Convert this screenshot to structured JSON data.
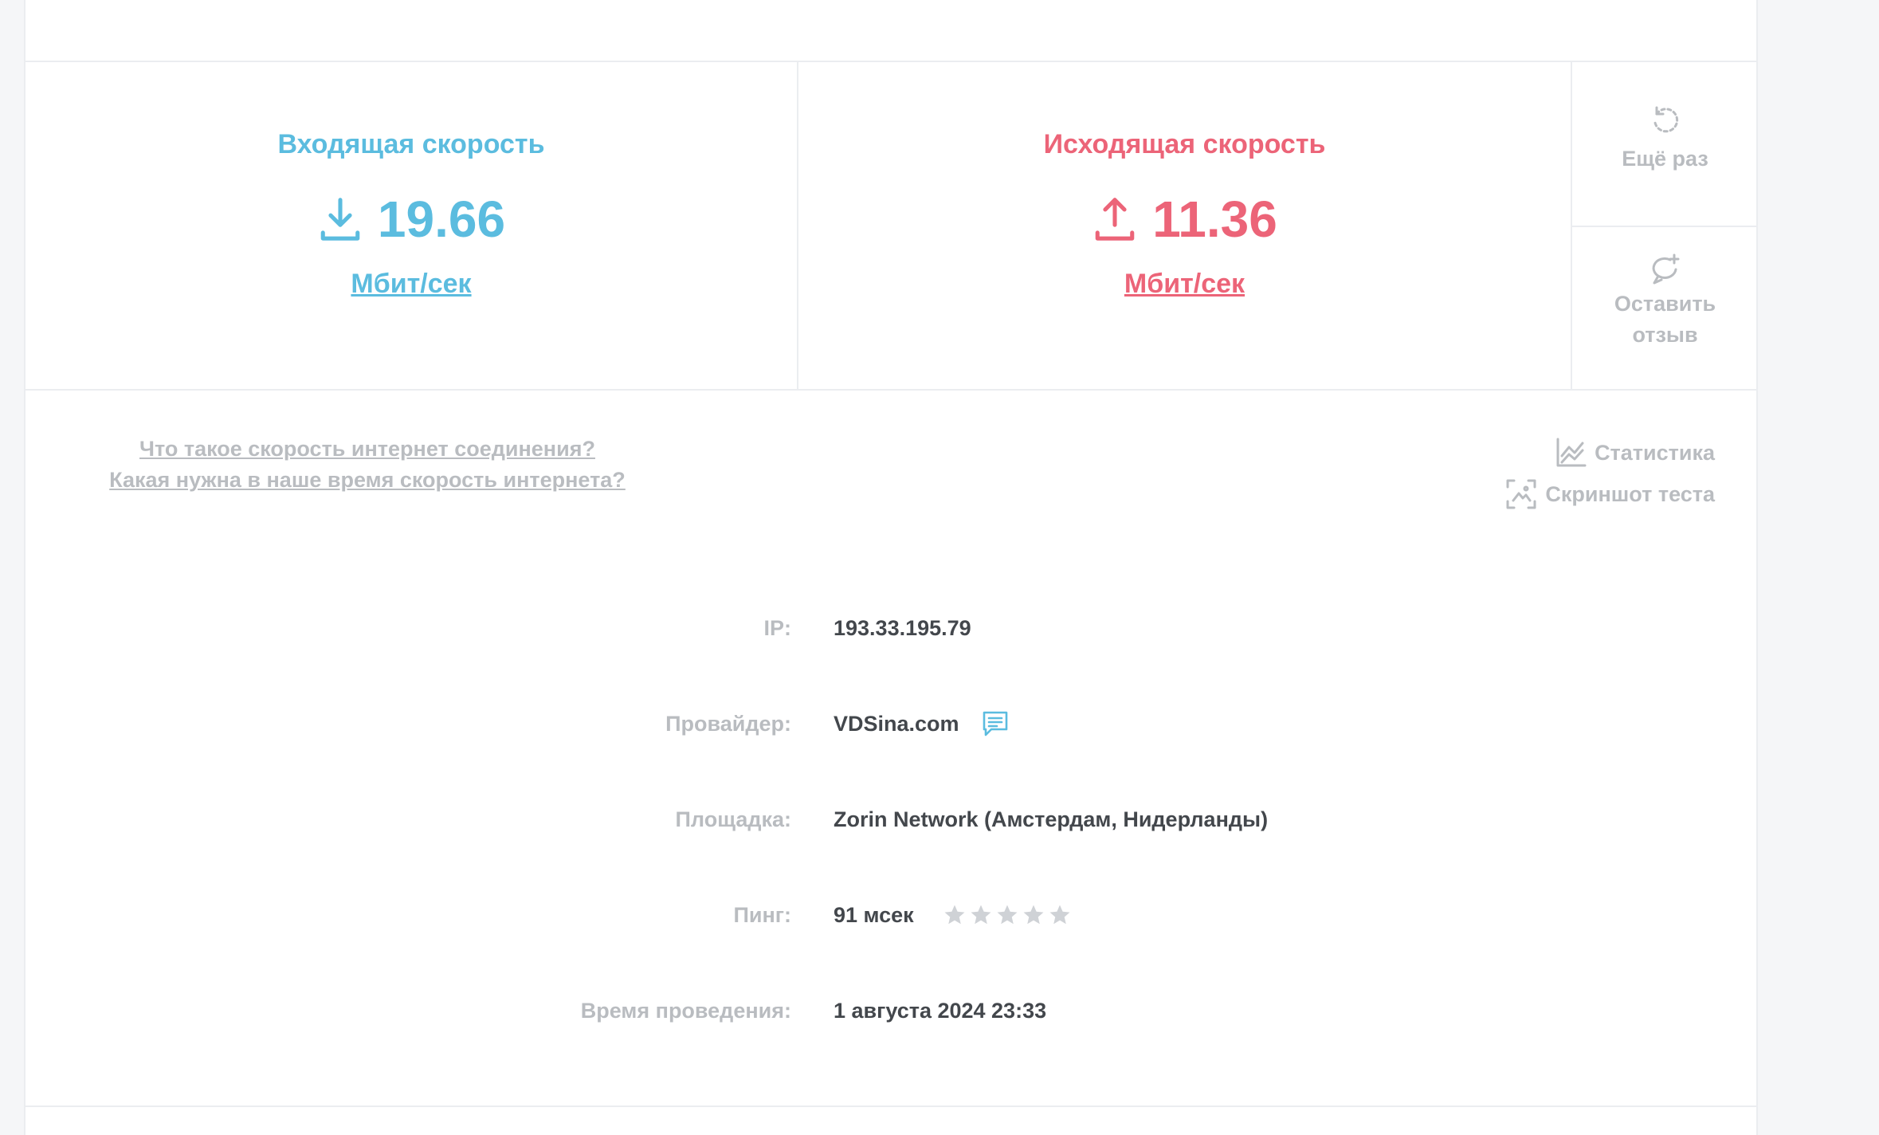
{
  "download": {
    "title": "Входящая скорость",
    "value": "19.66",
    "unit": "Мбит/сек",
    "color": "#5bbcdf",
    "icon": "download-icon"
  },
  "upload": {
    "title": "Исходящая скорость",
    "value": "11.36",
    "unit": "Мбит/сек",
    "color": "#ec6478",
    "icon": "upload-icon"
  },
  "actions": {
    "retry_label": "Ещё раз",
    "review_line1": "Оставить",
    "review_line2": "отзыв"
  },
  "help_links": [
    "Что такое скорость интернет соединения?",
    "Какая нужна в наше время скорость интернета?"
  ],
  "tools": {
    "stats_label": "Статистика",
    "screenshot_label": "Скриншот теста"
  },
  "info": {
    "ip_label": "IP:",
    "ip_value": "193.33.195.79",
    "provider_label": "Провайдер:",
    "provider_value": "VDSina.com",
    "site_label": "Площадка:",
    "site_value": "Zorin Network (Амстердам, Нидерланды)",
    "ping_label": "Пинг:",
    "ping_value": "91 мсек",
    "ping_rating": 0,
    "ping_rating_max": 5,
    "time_label": "Время проведения:",
    "time_value": "1 августа 2024 23:33"
  }
}
